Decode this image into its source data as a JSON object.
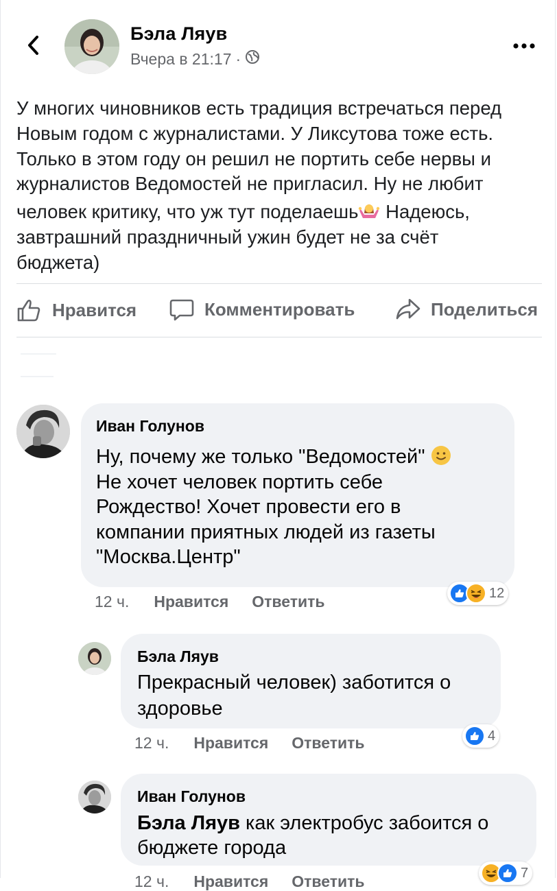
{
  "post": {
    "author": "Бэла Ляув",
    "time": "Вчера в 21:17",
    "separator": "·",
    "text_lines": [
      "У многих чиновников есть традиция встречаться перед",
      "Новым годом с журналистами. У Ликсутова тоже есть.",
      "Только в этом году он решил не портить себе нервы и",
      "журналистов Ведомостей не пригласил. Ну не любит",
      "человек критику, что уж тут поделаешь",
      " Надеюсь,",
      "завтрашний праздничный ужин будет не за счёт",
      "бюджета)"
    ],
    "icons": [
      "back-chevron-icon",
      "globe-icon",
      "more-icon",
      "woman-shrugging-emoji"
    ]
  },
  "actions": {
    "like": "Нравится",
    "comment": "Комментировать",
    "share": "Поделиться"
  },
  "comments": [
    {
      "author": "Иван Голунов",
      "lines": [
        "Ну, почему же только \"Ведомостей\"",
        "Не хочет человек портить себе",
        "Рождество! Хочет провести его в",
        "компании приятных людей из газеты",
        "\"Москва.Центр\""
      ],
      "time": "12 ч.",
      "like": "Нравится",
      "reply": "Ответить",
      "reaction_count": "12",
      "reactions": [
        "like",
        "haha"
      ]
    },
    {
      "author": "Бэла Ляув",
      "lines": [
        "Прекрасный человек) заботится о",
        "здоровье"
      ],
      "time": "12 ч.",
      "like": "Нравится",
      "reply": "Ответить",
      "reaction_count": "4",
      "reactions": [
        "like"
      ]
    },
    {
      "author": "Иван Голунов",
      "mention": "Бэла Ляув",
      "lines": [
        " как электробус забоится о",
        "бюджете города"
      ],
      "time": "12 ч.",
      "like": "Нравится",
      "reply": "Ответить",
      "reaction_count": "7",
      "reactions": [
        "haha",
        "like"
      ]
    }
  ],
  "colors": {
    "accent": "#1877f2",
    "muted": "#65676b",
    "bubble": "#f0f2f5",
    "haha": "#f7b125"
  }
}
